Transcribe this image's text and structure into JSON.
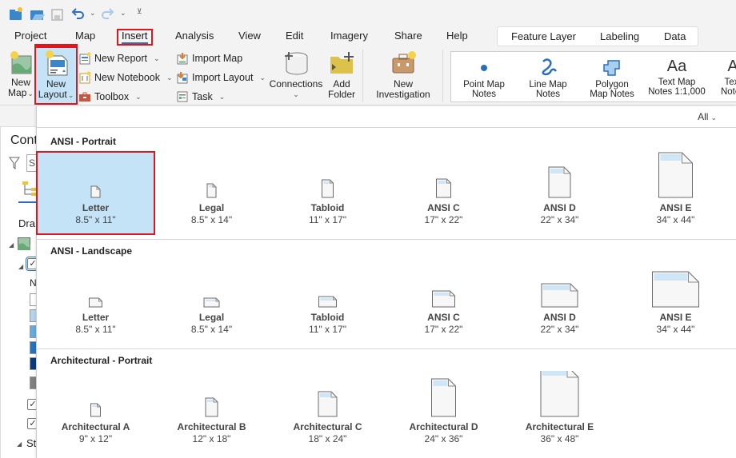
{
  "quick_access": {
    "icons": [
      "new-project-icon",
      "open-project-icon",
      "save-project-icon",
      "undo-icon",
      "redo-icon",
      "customize-toolbar-icon"
    ]
  },
  "tabs": [
    {
      "label": "Project"
    },
    {
      "label": "Map"
    },
    {
      "label": "Insert",
      "active": true
    },
    {
      "label": "Analysis"
    },
    {
      "label": "View"
    },
    {
      "label": "Edit"
    },
    {
      "label": "Imagery"
    },
    {
      "label": "Share"
    },
    {
      "label": "Help"
    }
  ],
  "context_tabs": [
    {
      "label": "Feature Layer"
    },
    {
      "label": "Labeling"
    },
    {
      "label": "Data"
    }
  ],
  "ribbon": {
    "new_map": {
      "line1": "New",
      "line2": "Map"
    },
    "new_layout": {
      "line1": "New",
      "line2": "Layout"
    },
    "new_report": "New Report",
    "new_notebook": "New Notebook",
    "toolbox": "Toolbox",
    "import_map": "Import Map",
    "import_layout": "Import Layout",
    "task": "Task",
    "connections": "Connections",
    "add_folder": {
      "line1": "Add",
      "line2": "Folder"
    },
    "new_investigation": {
      "line1": "New",
      "line2": "Investigation"
    },
    "gallery": [
      {
        "line1": "Point Map",
        "line2": "Notes"
      },
      {
        "line1": "Line Map",
        "line2": "Notes"
      },
      {
        "line1": "Polygon",
        "line2": "Map Notes"
      },
      {
        "line1": "Text Map",
        "line2": "Notes 1:1,000"
      },
      {
        "line1": "Text",
        "line2": "Notes"
      }
    ]
  },
  "contents_pane": {
    "title": "Cont",
    "draw_order": "Dra",
    "search_placeholder": "S",
    "layer_prefix": "N",
    "stand_prefix": "Sta"
  },
  "dropdown": {
    "filter_label": "All",
    "sections": [
      {
        "title": "ANSI - Portrait",
        "items": [
          {
            "name": "Letter",
            "size": "8.5\" x 11\"",
            "selected": true
          },
          {
            "name": "Legal",
            "size": "8.5\" x 14\""
          },
          {
            "name": "Tabloid",
            "size": "11\" x 17\""
          },
          {
            "name": "ANSI C",
            "size": "17\" x 22\""
          },
          {
            "name": "ANSI D",
            "size": "22\" x 34\""
          },
          {
            "name": "ANSI E",
            "size": "34\" x 44\""
          }
        ]
      },
      {
        "title": "ANSI - Landscape",
        "items": [
          {
            "name": "Letter",
            "size": "8.5\" x 11\""
          },
          {
            "name": "Legal",
            "size": "8.5\" x 14\""
          },
          {
            "name": "Tabloid",
            "size": "11\" x 17\""
          },
          {
            "name": "ANSI C",
            "size": "17\" x 22\""
          },
          {
            "name": "ANSI D",
            "size": "22\" x 34\""
          },
          {
            "name": "ANSI E",
            "size": "34\" x 44\""
          }
        ]
      },
      {
        "title": "Architectural - Portrait",
        "items": [
          {
            "name": "Architectural A",
            "size": "9\" x 12\""
          },
          {
            "name": "Architectural B",
            "size": "12\" x 18\""
          },
          {
            "name": "Architectural C",
            "size": "18\" x 24\""
          },
          {
            "name": "Architectural D",
            "size": "24\" x 36\""
          },
          {
            "name": "Architectural E",
            "size": "36\" x 48\""
          }
        ]
      }
    ]
  },
  "colors": {
    "accent": "#2a6ebb",
    "highlight_box": "#e0161e",
    "selected_tile": "#c5e3f6",
    "page_header_band": "#cfe6f7"
  }
}
